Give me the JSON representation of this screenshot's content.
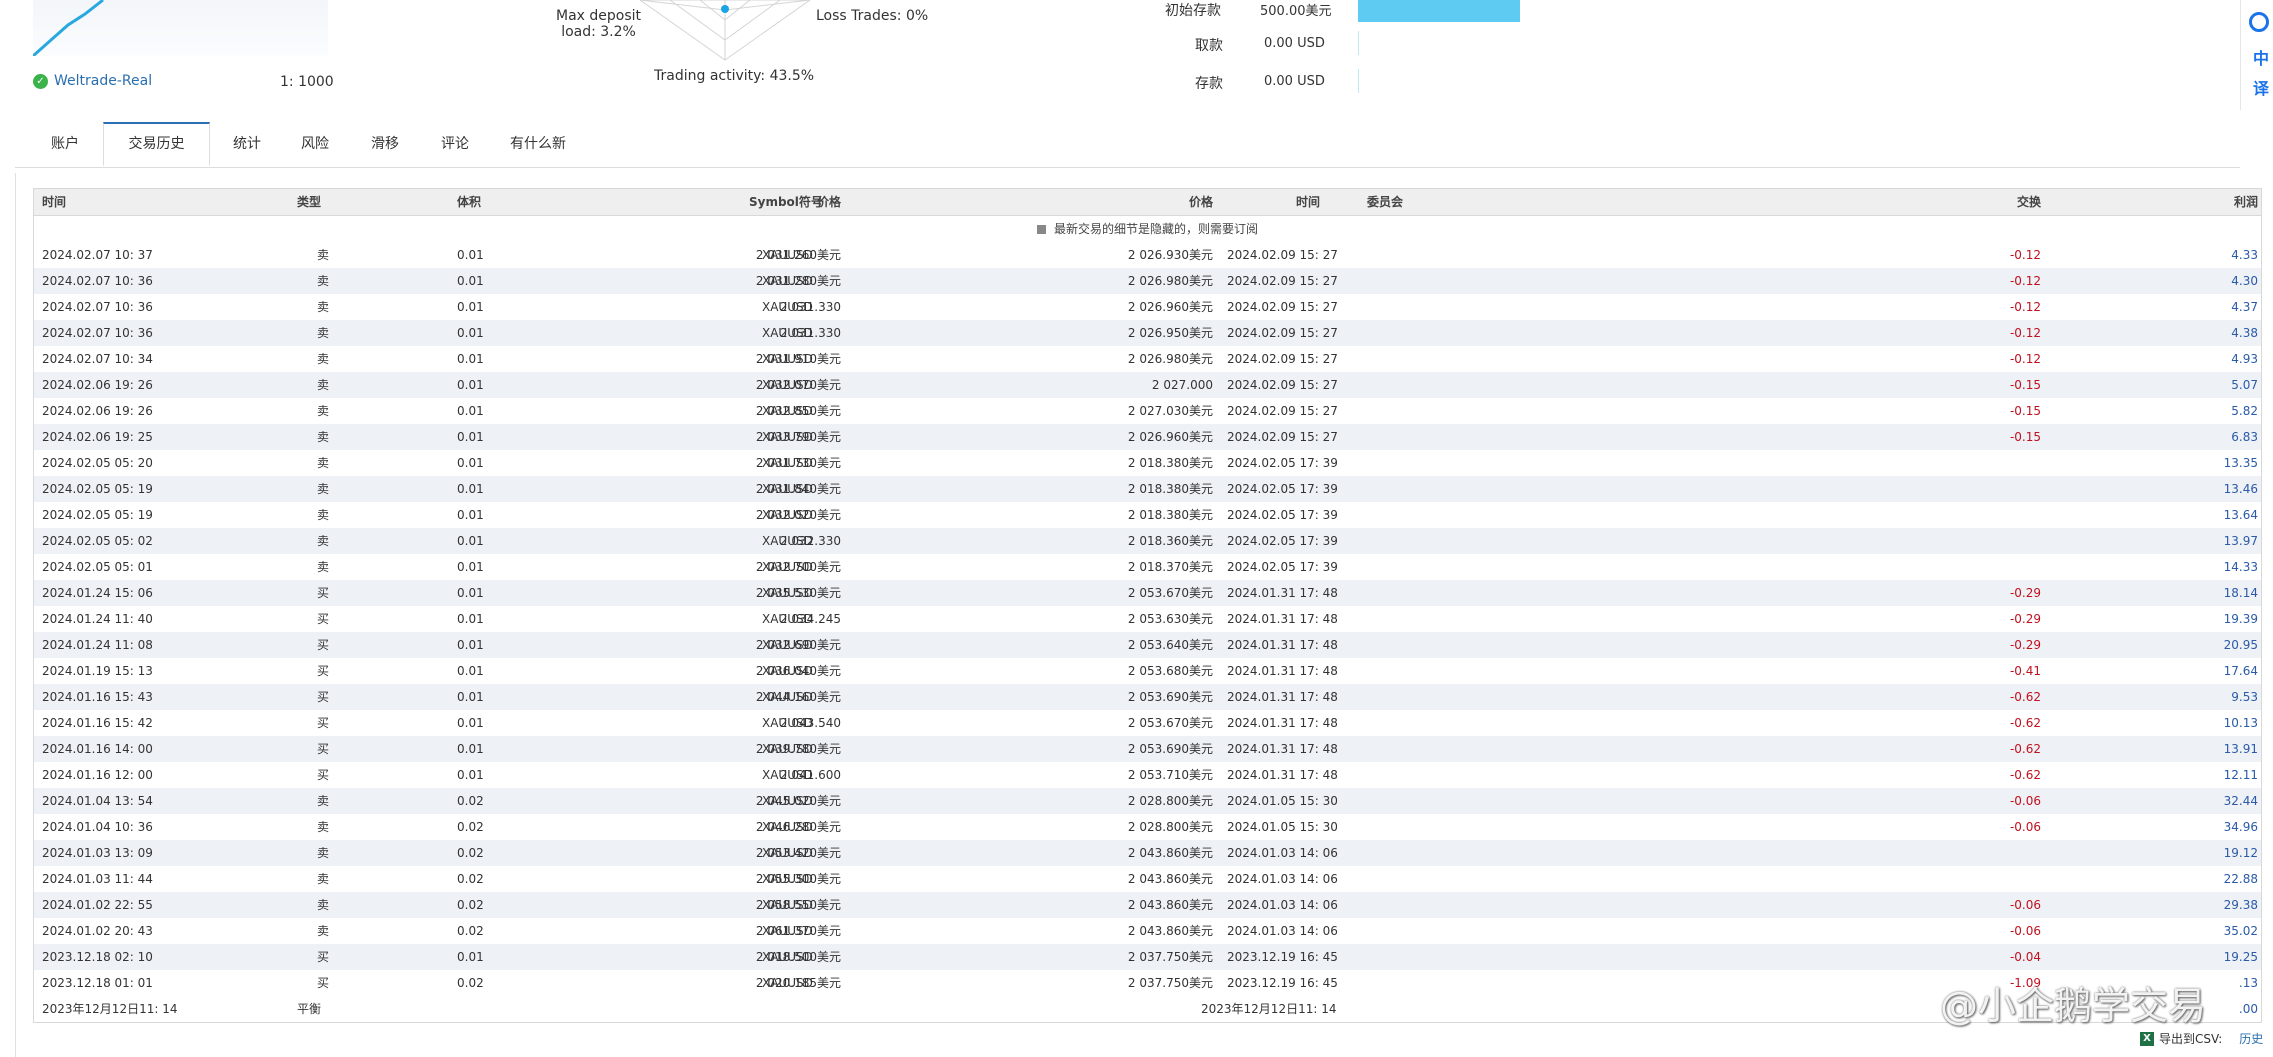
{
  "summary": {
    "broker": "Weltrade-Real",
    "leverage": "1:  1000",
    "radar": {
      "max_deposit_label": "Max deposit",
      "max_deposit_value": "load: 3.2%",
      "loss_trades": "Loss Trades: 0%",
      "trading_activity": "Trading activity: 43.5%"
    },
    "finance": [
      {
        "label": "初始存款",
        "value": "500.00美元"
      },
      {
        "label": "取款",
        "value": "0.00 USD"
      },
      {
        "label": "存款",
        "value": "0.00 USD"
      }
    ]
  },
  "side_icons": [
    "中",
    "译"
  ],
  "tabs": [
    {
      "label": "账户",
      "active": false
    },
    {
      "label": "交易历史",
      "active": true
    },
    {
      "label": "统计",
      "active": false
    },
    {
      "label": "风险",
      "active": false
    },
    {
      "label": "滑移",
      "active": false
    },
    {
      "label": "评论",
      "active": false
    },
    {
      "label": "有什么新",
      "active": false
    }
  ],
  "table": {
    "headers": [
      "时间",
      "类型",
      "体积",
      "Symbol符号",
      "价格",
      "时间",
      "价格",
      "委员会",
      "交换",
      "利润"
    ],
    "notice": "最新交易的细节是隐藏的，则需要订阅",
    "rows": [
      [
        "2024.02.07 10: 37",
        "卖",
        "0.01",
        "XAUUSD",
        "2 031.260美元",
        "2024.02.09 15: 27",
        "2 026.930美元",
        "",
        "-0.12",
        "4.33"
      ],
      [
        "2024.02.07 10: 36",
        "卖",
        "0.01",
        "XAUUSD",
        "2 031.280美元",
        "2024.02.09 15: 27",
        "2 026.980美元",
        "",
        "-0.12",
        "4.30"
      ],
      [
        "2024.02.07 10: 36",
        "卖",
        "0.01",
        "XAUUSD",
        "2 031.330",
        "2024.02.09 15: 27",
        "2 026.960美元",
        "",
        "-0.12",
        "4.37"
      ],
      [
        "2024.02.07 10: 36",
        "卖",
        "0.01",
        "XAUUSD",
        "2 031.330",
        "2024.02.09 15: 27",
        "2 026.950美元",
        "",
        "-0.12",
        "4.38"
      ],
      [
        "2024.02.07 10: 34",
        "卖",
        "0.01",
        "XAUUSD",
        "2 031.910美元",
        "2024.02.09 15: 27",
        "2 026.980美元",
        "",
        "-0.12",
        "4.93"
      ],
      [
        "2024.02.06 19: 26",
        "卖",
        "0.01",
        "XAUUSD",
        "2 032.070美元",
        "2024.02.09 15: 27",
        "2 027.000",
        "",
        "-0.15",
        "5.07"
      ],
      [
        "2024.02.06 19: 26",
        "卖",
        "0.01",
        "XAUUSD",
        "2 032.850美元",
        "2024.02.09 15: 27",
        "2 027.030美元",
        "",
        "-0.15",
        "5.82"
      ],
      [
        "2024.02.06 19: 25",
        "卖",
        "0.01",
        "XAUUSD",
        "2 033.790美元",
        "2024.02.09 15: 27",
        "2 026.960美元",
        "",
        "-0.15",
        "6.83"
      ],
      [
        "2024.02.05 05: 20",
        "卖",
        "0.01",
        "XAUUSD",
        "2 031.730美元",
        "2024.02.05 17: 39",
        "2 018.380美元",
        "",
        "",
        "13.35"
      ],
      [
        "2024.02.05 05: 19",
        "卖",
        "0.01",
        "XAUUSD",
        "2 031.840美元",
        "2024.02.05 17: 39",
        "2 018.380美元",
        "",
        "",
        "13.46"
      ],
      [
        "2024.02.05 05: 19",
        "卖",
        "0.01",
        "XAUUSD",
        "2 032.020美元",
        "2024.02.05 17: 39",
        "2 018.380美元",
        "",
        "",
        "13.64"
      ],
      [
        "2024.02.05 05: 02",
        "卖",
        "0.01",
        "XAUUSD",
        "2 032.330",
        "2024.02.05 17: 39",
        "2 018.360美元",
        "",
        "",
        "13.97"
      ],
      [
        "2024.02.05 05: 01",
        "卖",
        "0.01",
        "XAUUSD",
        "2 032.700美元",
        "2024.02.05 17: 39",
        "2 018.370美元",
        "",
        "",
        "14.33"
      ],
      [
        "2024.01.24 15: 06",
        "买",
        "0.01",
        "XAUUSD",
        "2 035.530美元",
        "2024.01.31 17: 48",
        "2 053.670美元",
        "",
        "-0.29",
        "18.14"
      ],
      [
        "2024.01.24 11: 40",
        "买",
        "0.01",
        "XAUUSD",
        "2 034.245",
        "2024.01.31 17: 48",
        "2 053.630美元",
        "",
        "-0.29",
        "19.39"
      ],
      [
        "2024.01.24 11: 08",
        "买",
        "0.01",
        "XAUUSD",
        "2 032.690美元",
        "2024.01.31 17: 48",
        "2 053.640美元",
        "",
        "-0.29",
        "20.95"
      ],
      [
        "2024.01.19 15: 13",
        "买",
        "0.01",
        "XAUUSD",
        "2 036.040美元",
        "2024.01.31 17: 48",
        "2 053.680美元",
        "",
        "-0.41",
        "17.64"
      ],
      [
        "2024.01.16 15: 43",
        "买",
        "0.01",
        "XAUUSD",
        "2 044.160美元",
        "2024.01.31 17: 48",
        "2 053.690美元",
        "",
        "-0.62",
        "9.53"
      ],
      [
        "2024.01.16 15: 42",
        "买",
        "0.01",
        "XAUUSD",
        "2 043.540",
        "2024.01.31 17: 48",
        "2 053.670美元",
        "",
        "-0.62",
        "10.13"
      ],
      [
        "2024.01.16 14: 00",
        "买",
        "0.01",
        "XAUUSD",
        "2 039.780美元",
        "2024.01.31 17: 48",
        "2 053.690美元",
        "",
        "-0.62",
        "13.91"
      ],
      [
        "2024.01.16 12: 00",
        "买",
        "0.01",
        "XAUUSD",
        "2 041.600",
        "2024.01.31 17: 48",
        "2 053.710美元",
        "",
        "-0.62",
        "12.11"
      ],
      [
        "2024.01.04 13: 54",
        "卖",
        "0.02",
        "XAUUSD",
        "2 045.020美元",
        "2024.01.05 15: 30",
        "2 028.800美元",
        "",
        "-0.06",
        "32.44"
      ],
      [
        "2024.01.04 10: 36",
        "卖",
        "0.02",
        "XAUUSD",
        "2 046.280美元",
        "2024.01.05 15: 30",
        "2 028.800美元",
        "",
        "-0.06",
        "34.96"
      ],
      [
        "2024.01.03 13: 09",
        "卖",
        "0.02",
        "XAUUSD",
        "2 053.420美元",
        "2024.01.03 14: 06",
        "2 043.860美元",
        "",
        "",
        "19.12"
      ],
      [
        "2024.01.03 11: 44",
        "卖",
        "0.02",
        "XAUUSD",
        "2 055.300美元",
        "2024.01.03 14: 06",
        "2 043.860美元",
        "",
        "",
        "22.88"
      ],
      [
        "2024.01.02 22: 55",
        "卖",
        "0.02",
        "XAUUSD",
        "2 058.550美元",
        "2024.01.03 14: 06",
        "2 043.860美元",
        "",
        "-0.06",
        "29.38"
      ],
      [
        "2024.01.02 20: 43",
        "卖",
        "0.02",
        "XAUUSD",
        "2 061.370美元",
        "2024.01.03 14: 06",
        "2 043.860美元",
        "",
        "-0.06",
        "35.02"
      ],
      [
        "2023.12.18 02: 10",
        "买",
        "0.01",
        "XAUUSD",
        "2 018.500美元",
        "2023.12.19 16: 45",
        "2 037.750美元",
        "",
        "-0.04",
        "19.25"
      ],
      [
        "2023.12.18 01: 01",
        "买",
        "0.02",
        "XAUUSD",
        "2 020.185美元",
        "2023.12.19 16: 45",
        "2 037.750美元",
        "",
        "-1.09",
        "  .13"
      ]
    ],
    "footer": {
      "open_time": "2023年12月12日11: 14",
      "type": "平衡",
      "close_time": "2023年12月12日11: 14",
      "profit": ".00"
    }
  },
  "export": {
    "label": "导出到CSV:",
    "history": "历史",
    "icon": "X"
  },
  "watermark": "@小企鹅学交易",
  "colors": {
    "accent": "#2a6fb0",
    "negative": "#c0111f",
    "bar": "#5ecbf2",
    "check": "#3bb34a"
  }
}
